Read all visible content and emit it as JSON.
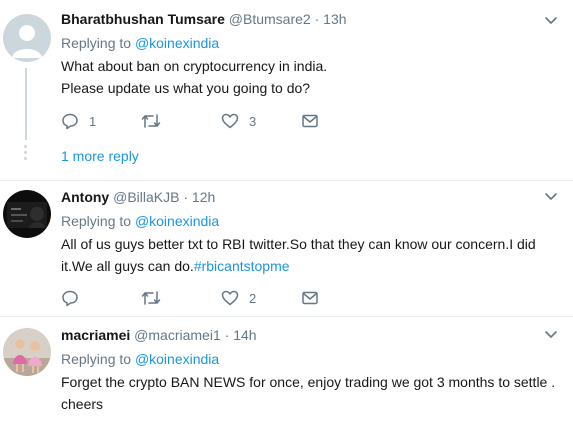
{
  "tweets": [
    {
      "name": "Bharatbhushan Tumsare",
      "handle": "@Btumsare2",
      "time": "13h",
      "replying_label": "Replying to",
      "replying_to": "@koinexindia",
      "text_lines": [
        "What about ban on cryptocurrency in india.",
        "Please update us what you going to do?"
      ],
      "reply_count": "1",
      "retweet_count": "",
      "like_count": "3",
      "avatar_icon": "default-profile-icon"
    },
    {
      "name": "Antony",
      "handle": "@BillaKJB",
      "time": "12h",
      "replying_label": "Replying to",
      "replying_to": "@koinexindia",
      "text_line1": "All of us guys better txt to RBI twitter.So that they can know our concern.I did",
      "text_line2_prefix": "it.We all guys can do.",
      "hashtag": "#rbicantstopme",
      "reply_count": "",
      "retweet_count": "",
      "like_count": "2"
    },
    {
      "name": "macriamei",
      "handle": "@macriamei1",
      "time": "14h",
      "replying_label": "Replying to",
      "replying_to": "@koinexindia",
      "text_lines": [
        "Forget the crypto BAN NEWS for once, enjoy trading we got 3 months to settle .",
        "cheers"
      ]
    }
  ],
  "more_replies": "1 more reply",
  "separator": "·",
  "colors": {
    "link": "#1b95e0",
    "secondary": "#657786",
    "divider": "#e6ecf0"
  }
}
